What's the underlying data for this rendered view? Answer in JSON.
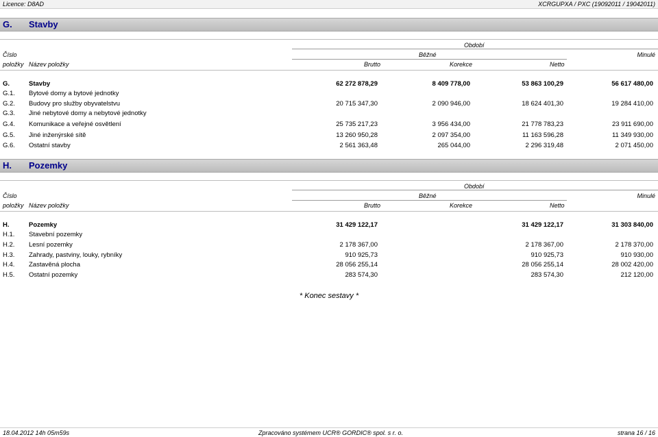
{
  "header": {
    "licence": "Licence: D8AD",
    "report_id": "XCRGUPXA / PXC (19092011 / 19042011)"
  },
  "column_headers": {
    "obdobi": "Období",
    "cislo": "Číslo",
    "polozky": "položky",
    "nazev": "Název položky",
    "bezne": "Běžné",
    "minule": "Minulé",
    "brutto": "Brutto",
    "korekce": "Korekce",
    "netto": "Netto"
  },
  "sections": [
    {
      "code": "G.",
      "title": "Stavby",
      "rows": [
        {
          "code": "G.",
          "name": "Stavby",
          "brutto": "62 272 878,29",
          "korekce": "8 409 778,00",
          "netto": "53 863 100,29",
          "minule": "56 617 480,00",
          "bold": true
        },
        {
          "code": "G.1.",
          "name": "Bytové domy a bytové jednotky",
          "brutto": "",
          "korekce": "",
          "netto": "",
          "minule": ""
        },
        {
          "code": "G.2.",
          "name": "Budovy pro služby obyvatelstvu",
          "brutto": "20 715 347,30",
          "korekce": "2 090 946,00",
          "netto": "18 624 401,30",
          "minule": "19 284 410,00"
        },
        {
          "code": "G.3.",
          "name": "Jiné nebytové domy a nebytové jednotky",
          "brutto": "",
          "korekce": "",
          "netto": "",
          "minule": ""
        },
        {
          "code": "G.4.",
          "name": "Komunikace a veřejné osvětlení",
          "brutto": "25 735 217,23",
          "korekce": "3 956 434,00",
          "netto": "21 778 783,23",
          "minule": "23 911 690,00"
        },
        {
          "code": "G.5.",
          "name": "Jiné inženýrské sítě",
          "brutto": "13 260 950,28",
          "korekce": "2 097 354,00",
          "netto": "11 163 596,28",
          "minule": "11 349 930,00"
        },
        {
          "code": "G.6.",
          "name": "Ostatní stavby",
          "brutto": "2 561 363,48",
          "korekce": "265 044,00",
          "netto": "2 296 319,48",
          "minule": "2 071 450,00"
        }
      ]
    },
    {
      "code": "H.",
      "title": "Pozemky",
      "rows": [
        {
          "code": "H.",
          "name": "Pozemky",
          "brutto": "31 429 122,17",
          "korekce": "",
          "netto": "31 429 122,17",
          "minule": "31 303 840,00",
          "bold": true
        },
        {
          "code": "H.1.",
          "name": "Stavební pozemky",
          "brutto": "",
          "korekce": "",
          "netto": "",
          "minule": ""
        },
        {
          "code": "H.2.",
          "name": "Lesní pozemky",
          "brutto": "2 178 367,00",
          "korekce": "",
          "netto": "2 178 367,00",
          "minule": "2 178 370,00"
        },
        {
          "code": "H.3.",
          "name": "Zahrady, pastviny, louky, rybníky",
          "brutto": "910 925,73",
          "korekce": "",
          "netto": "910 925,73",
          "minule": "910 930,00"
        },
        {
          "code": "H.4.",
          "name": "Zastavěná plocha",
          "brutto": "28 056 255,14",
          "korekce": "",
          "netto": "28 056 255,14",
          "minule": "28 002 420,00"
        },
        {
          "code": "H.5.",
          "name": "Ostatní pozemky",
          "brutto": "283 574,30",
          "korekce": "",
          "netto": "283 574,30",
          "minule": "212 120,00"
        }
      ]
    }
  ],
  "end_note": "* Konec sestavy *",
  "footer": {
    "datetime": "18.04.2012 14h 05m59s",
    "processed_by": "Zpracováno systémem UCR® GORDIC® spol. s  r. o.",
    "page": "strana 16 / 16"
  }
}
